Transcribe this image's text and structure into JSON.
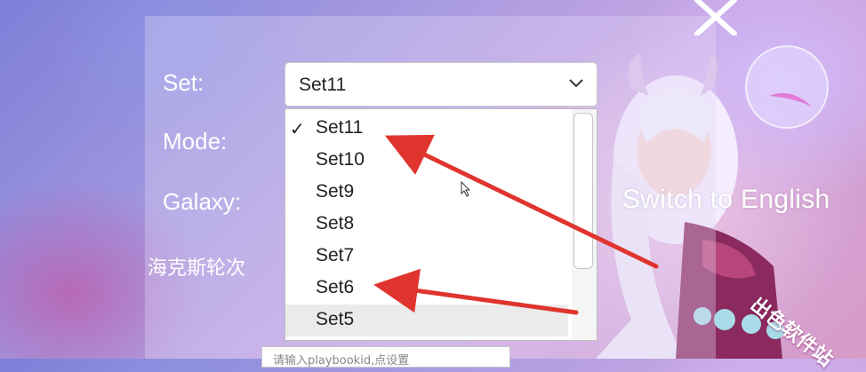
{
  "form": {
    "set_label": "Set:",
    "mode_label": "Mode:",
    "galaxy_label": "Galaxy:",
    "hextech_label": "海克斯轮次",
    "switch_language": "Switch to English",
    "playbook_placeholder": "请输入playbookid,点设置"
  },
  "set_select": {
    "selected": "Set11",
    "options": [
      {
        "label": "Set11",
        "checked": true
      },
      {
        "label": "Set10",
        "checked": false
      },
      {
        "label": "Set9",
        "checked": false
      },
      {
        "label": "Set8",
        "checked": false
      },
      {
        "label": "Set7",
        "checked": false
      },
      {
        "label": "Set6",
        "checked": false
      },
      {
        "label": "Set5",
        "checked": false
      }
    ],
    "check_glyph": "✓"
  },
  "watermark": "出色软件站",
  "icons": {
    "close": "close-icon",
    "dropdown": "chevron-down-icon",
    "check": "check-icon",
    "cursor": "mouse-cursor-icon"
  },
  "colors": {
    "annotation_arrow": "#e0342e",
    "panel_text": "#ffffff",
    "dropdown_hover": "#ebebeb"
  }
}
